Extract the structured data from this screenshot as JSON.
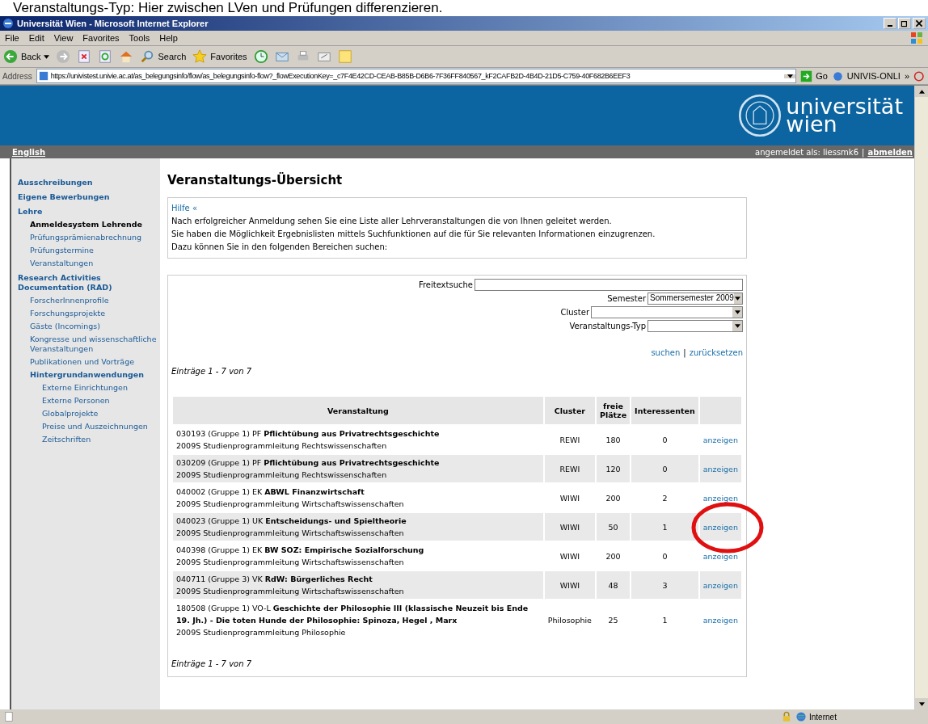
{
  "doc_caption": "Veranstaltungs-Typ: Hier zwischen LVen und Prüfungen differenzieren.",
  "window": {
    "title": "Universität Wien - Microsoft Internet Explorer"
  },
  "menu": [
    "File",
    "Edit",
    "View",
    "Favorites",
    "Tools",
    "Help"
  ],
  "toolbar": {
    "back": "Back",
    "search": "Search",
    "favorites": "Favorites"
  },
  "address": {
    "label": "Address",
    "value": "https://univistest.univie.ac.at/as_belegungsinfo/flow/as_belegungsinfo-flow?_flowExecutionKey=_c7F4E42CD-CEAB-B85B-D6B6-7F36FF840567_kF2CAFB2D-4B4D-21D5-C759-40F682B6EEF3",
    "go": "Go",
    "link": "UNIVIS-ONLI",
    "more": "»"
  },
  "banner": {
    "logo_line1": "universität",
    "logo_line2": "wien"
  },
  "userbar": {
    "language": "English",
    "logged_in": "angemeldet als: liessmk6",
    "separator": "|",
    "logout": "abmelden"
  },
  "sidebar": {
    "items": [
      {
        "label": "Ausschreibungen",
        "selected": false
      },
      {
        "label": "Eigene Bewerbungen",
        "selected": false
      },
      {
        "label": "Lehre",
        "selected": false,
        "children": [
          {
            "label": "Anmeldesystem Lehrende",
            "selected": true
          },
          {
            "label": "Prüfungsprämienabrechnung",
            "selected": false
          },
          {
            "label": "Prüfungstermine",
            "selected": false
          },
          {
            "label": "Veranstaltungen",
            "selected": false
          }
        ]
      },
      {
        "label": "Research Activities Documentation (RAD)",
        "selected": false,
        "children": [
          {
            "label": "ForscherInnenprofile",
            "selected": false
          },
          {
            "label": "Forschungsprojekte",
            "selected": false
          },
          {
            "label": "Gäste (Incomings)",
            "selected": false
          },
          {
            "label": "Kongresse und wissenschaftliche Veranstaltungen",
            "selected": false
          },
          {
            "label": "Publikationen und Vorträge",
            "selected": false
          },
          {
            "label": "Hintergrundanwendungen",
            "selected": false,
            "children": [
              {
                "label": "Externe Einrichtungen",
                "selected": false
              },
              {
                "label": "Externe Personen",
                "selected": false
              },
              {
                "label": "Globalprojekte",
                "selected": false
              },
              {
                "label": "Preise und Auszeichnungen",
                "selected": false
              },
              {
                "label": "Zeitschriften",
                "selected": false
              }
            ]
          }
        ]
      }
    ]
  },
  "page_title": "Veranstaltungs-Übersicht",
  "help": {
    "toggle": "Hilfe «",
    "lines": [
      "Nach erfolgreicher Anmeldung sehen Sie eine Liste aller Lehrveranstaltungen die von Ihnen geleitet werden.",
      "Sie haben die Möglichkeit Ergebnislisten mittels Suchfunktionen auf die für Sie relevanten Informationen einzugrenzen.",
      "Dazu können Sie in den folgenden Bereichen suchen:"
    ]
  },
  "filters": [
    {
      "kind": "text",
      "label": "Freitextsuche"
    },
    {
      "kind": "select",
      "label": "Semester",
      "value": "Sommersemester 2009"
    },
    {
      "kind": "select",
      "label": "Cluster"
    },
    {
      "kind": "select",
      "label": "Veranstaltungs-Typ"
    }
  ],
  "actions": {
    "search": "suchen",
    "separator": "|",
    "reset": "zurücksetzen"
  },
  "entries_top": "Einträge 1 - 7 von 7",
  "table": {
    "columns": [
      "Veranstaltung",
      "Cluster",
      "freie Plätze",
      "Interessenten"
    ],
    "rows": [
      {
        "title": "030193 (Gruppe 1) PF **Pflichtübung aus Privatrechtsgeschichte**",
        "subtitle": "2009S Studienprogrammleitung Rechtswissenschaften",
        "cluster": "REWI",
        "free": "180",
        "interested": "0",
        "action": "anzeigen",
        "highlighted": false
      },
      {
        "title": "030209 (Gruppe 1) PF **Pflichtübung aus Privatrechtsgeschichte**",
        "subtitle": "2009S Studienprogrammleitung Rechtswissenschaften",
        "cluster": "REWI",
        "free": "120",
        "interested": "0",
        "action": "anzeigen",
        "highlighted": false
      },
      {
        "title": "040002 (Gruppe 1) EK **ABWL Finanzwirtschaft**",
        "subtitle": "2009S Studienprogrammleitung Wirtschaftswissenschaften",
        "cluster": "WIWI",
        "free": "200",
        "interested": "2",
        "action": "anzeigen",
        "highlighted": false
      },
      {
        "title": "040023 (Gruppe 1) UK **Entscheidungs- und Spieltheorie**",
        "subtitle": "2009S Studienprogrammleitung Wirtschaftswissenschaften",
        "cluster": "WIWI",
        "free": "50",
        "interested": "1",
        "action": "anzeigen",
        "highlighted": true
      },
      {
        "title": "040398 (Gruppe 1) EK **BW SOZ: Empirische Sozialforschung**",
        "subtitle": "2009S Studienprogrammleitung Wirtschaftswissenschaften",
        "cluster": "WIWI",
        "free": "200",
        "interested": "0",
        "action": "anzeigen",
        "highlighted": false
      },
      {
        "title": "040711 (Gruppe 3) VK **RdW: Bürgerliches Recht**",
        "subtitle": "2009S Studienprogrammleitung Wirtschaftswissenschaften",
        "cluster": "WIWI",
        "free": "48",
        "interested": "3",
        "action": "anzeigen",
        "highlighted": false
      },
      {
        "title": "180508 (Gruppe 1) VO-L **Geschichte der Philosophie III (klassische Neuzeit bis Ende 19. Jh.) - Die toten Hunde der Philosophie: Spinoza, Hegel , Marx**",
        "subtitle": "2009S Studienprogrammleitung Philosophie",
        "cluster": "Philosophie",
        "free": "25",
        "interested": "1",
        "action": "anzeigen",
        "highlighted": false
      }
    ]
  },
  "entries_bottom": "Einträge 1 - 7 von 7",
  "status_bar": {
    "zone": "Internet"
  }
}
